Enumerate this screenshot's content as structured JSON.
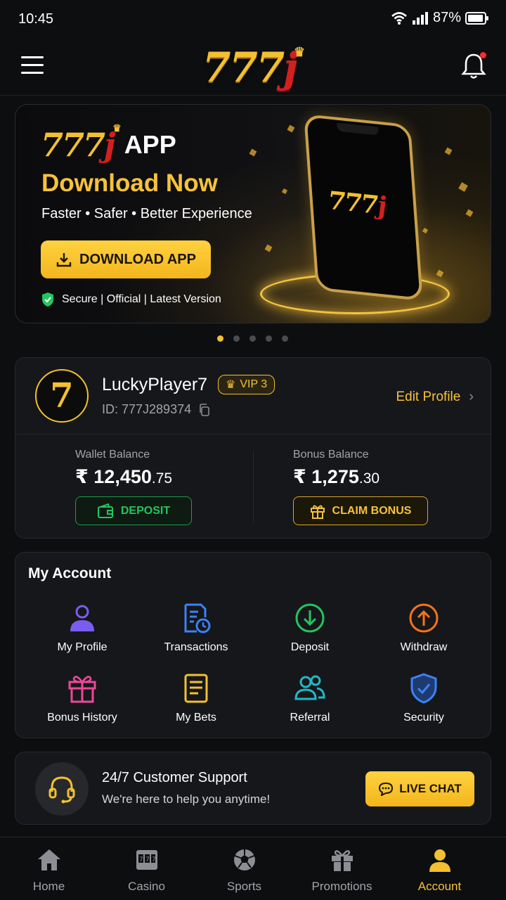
{
  "status_bar": {
    "time": "10:45",
    "battery": "87%"
  },
  "header": {
    "logo": "777",
    "logo_j": "j"
  },
  "banner": {
    "logo": "777",
    "logo_j": "j",
    "app_label": "APP",
    "headline": "Download Now",
    "subtitle": "Faster • Safer • Better Experience",
    "button_label": "DOWNLOAD APP",
    "secure_text": "Secure | Official | Latest Version",
    "phone_logo": "777",
    "phone_logo_j": "j",
    "slides": 5,
    "active_slide": 1
  },
  "profile": {
    "avatar": "7",
    "username": "LuckyPlayer7",
    "vip": "VIP 3",
    "id_text": "ID: 777J289374",
    "edit_label": "Edit Profile",
    "wallet_label": "Wallet Balance",
    "wallet_main": "₹ 12,450",
    "wallet_dec": ".75",
    "bonus_label": "Bonus Balance",
    "bonus_main": "₹ 1,275",
    "bonus_dec": ".30",
    "deposit_label": "DEPOSIT",
    "claim_label": "CLAIM BONUS"
  },
  "account": {
    "title": "My Account",
    "items": [
      {
        "label": "My Profile",
        "icon": "user-icon",
        "color": "#7c5cf0"
      },
      {
        "label": "Transactions",
        "icon": "receipt-clock-icon",
        "color": "#3b82f6"
      },
      {
        "label": "Deposit",
        "icon": "arrow-down-circle-icon",
        "color": "#22c55e"
      },
      {
        "label": "Withdraw",
        "icon": "arrow-up-circle-icon",
        "color": "#f97316"
      },
      {
        "label": "Bonus History",
        "icon": "gift-icon",
        "color": "#ec4899"
      },
      {
        "label": "My Bets",
        "icon": "document-icon",
        "color": "#f3c030"
      },
      {
        "label": "Referral",
        "icon": "users-icon",
        "color": "#22b8c5"
      },
      {
        "label": "Security",
        "icon": "shield-check-icon",
        "color": "#3b82f6"
      }
    ]
  },
  "support": {
    "title": "24/7 Customer Support",
    "subtitle": "We're here to help you anytime!",
    "button_label": "LIVE CHAT"
  },
  "bottom_nav": {
    "items": [
      {
        "label": "Home",
        "icon": "home-icon"
      },
      {
        "label": "Casino",
        "icon": "slot-machine-icon"
      },
      {
        "label": "Sports",
        "icon": "soccer-ball-icon"
      },
      {
        "label": "Promotions",
        "icon": "gift-icon"
      },
      {
        "label": "Account",
        "icon": "user-icon"
      }
    ],
    "active": "Account"
  },
  "colors": {
    "accent": "#f3c030",
    "background": "#0d0e10",
    "card": "#16171a",
    "success": "#22c55e"
  }
}
